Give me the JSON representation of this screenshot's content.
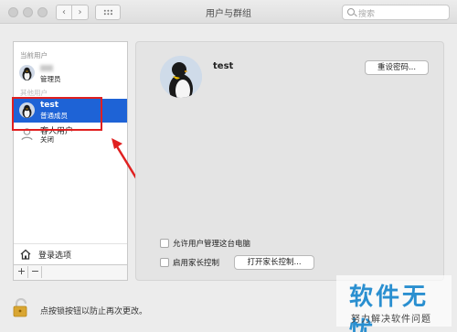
{
  "window": {
    "title": "用户与群组"
  },
  "toolbar": {
    "back_icon": "chevron-left-icon",
    "forward_icon": "chevron-right-icon",
    "show_all_icon": "grid-icon"
  },
  "search": {
    "placeholder": "搜索"
  },
  "sidebar": {
    "current_users_label": "当前用户",
    "other_users_label": "其他用户",
    "current_user": {
      "name": "",
      "role": "管理员"
    },
    "other_users": [
      {
        "name": "test",
        "role": "普通成员",
        "selected": true
      },
      {
        "name": "客人用户",
        "role": "关闭",
        "selected": false
      }
    ],
    "login_options_label": "登录选项",
    "add_label": "+",
    "remove_label": "−"
  },
  "detail": {
    "user_name": "test",
    "reset_password_label": "重设密码...",
    "allow_admin_label": "允许用户管理这台电脑",
    "allow_admin_checked": false,
    "parental_controls_label": "启用家长控制",
    "parental_controls_checked": false,
    "open_parental_controls_label": "打开家长控制..."
  },
  "footer": {
    "lock_text": "点按锁按钮以防止再次更改。"
  },
  "watermark": {
    "title": "软件无忧",
    "subtitle": "努力解决软件问题"
  },
  "annotation": {
    "color": "#e02020"
  },
  "colors": {
    "selection": "#1e63d6",
    "watermark": "#2a8fd0"
  }
}
